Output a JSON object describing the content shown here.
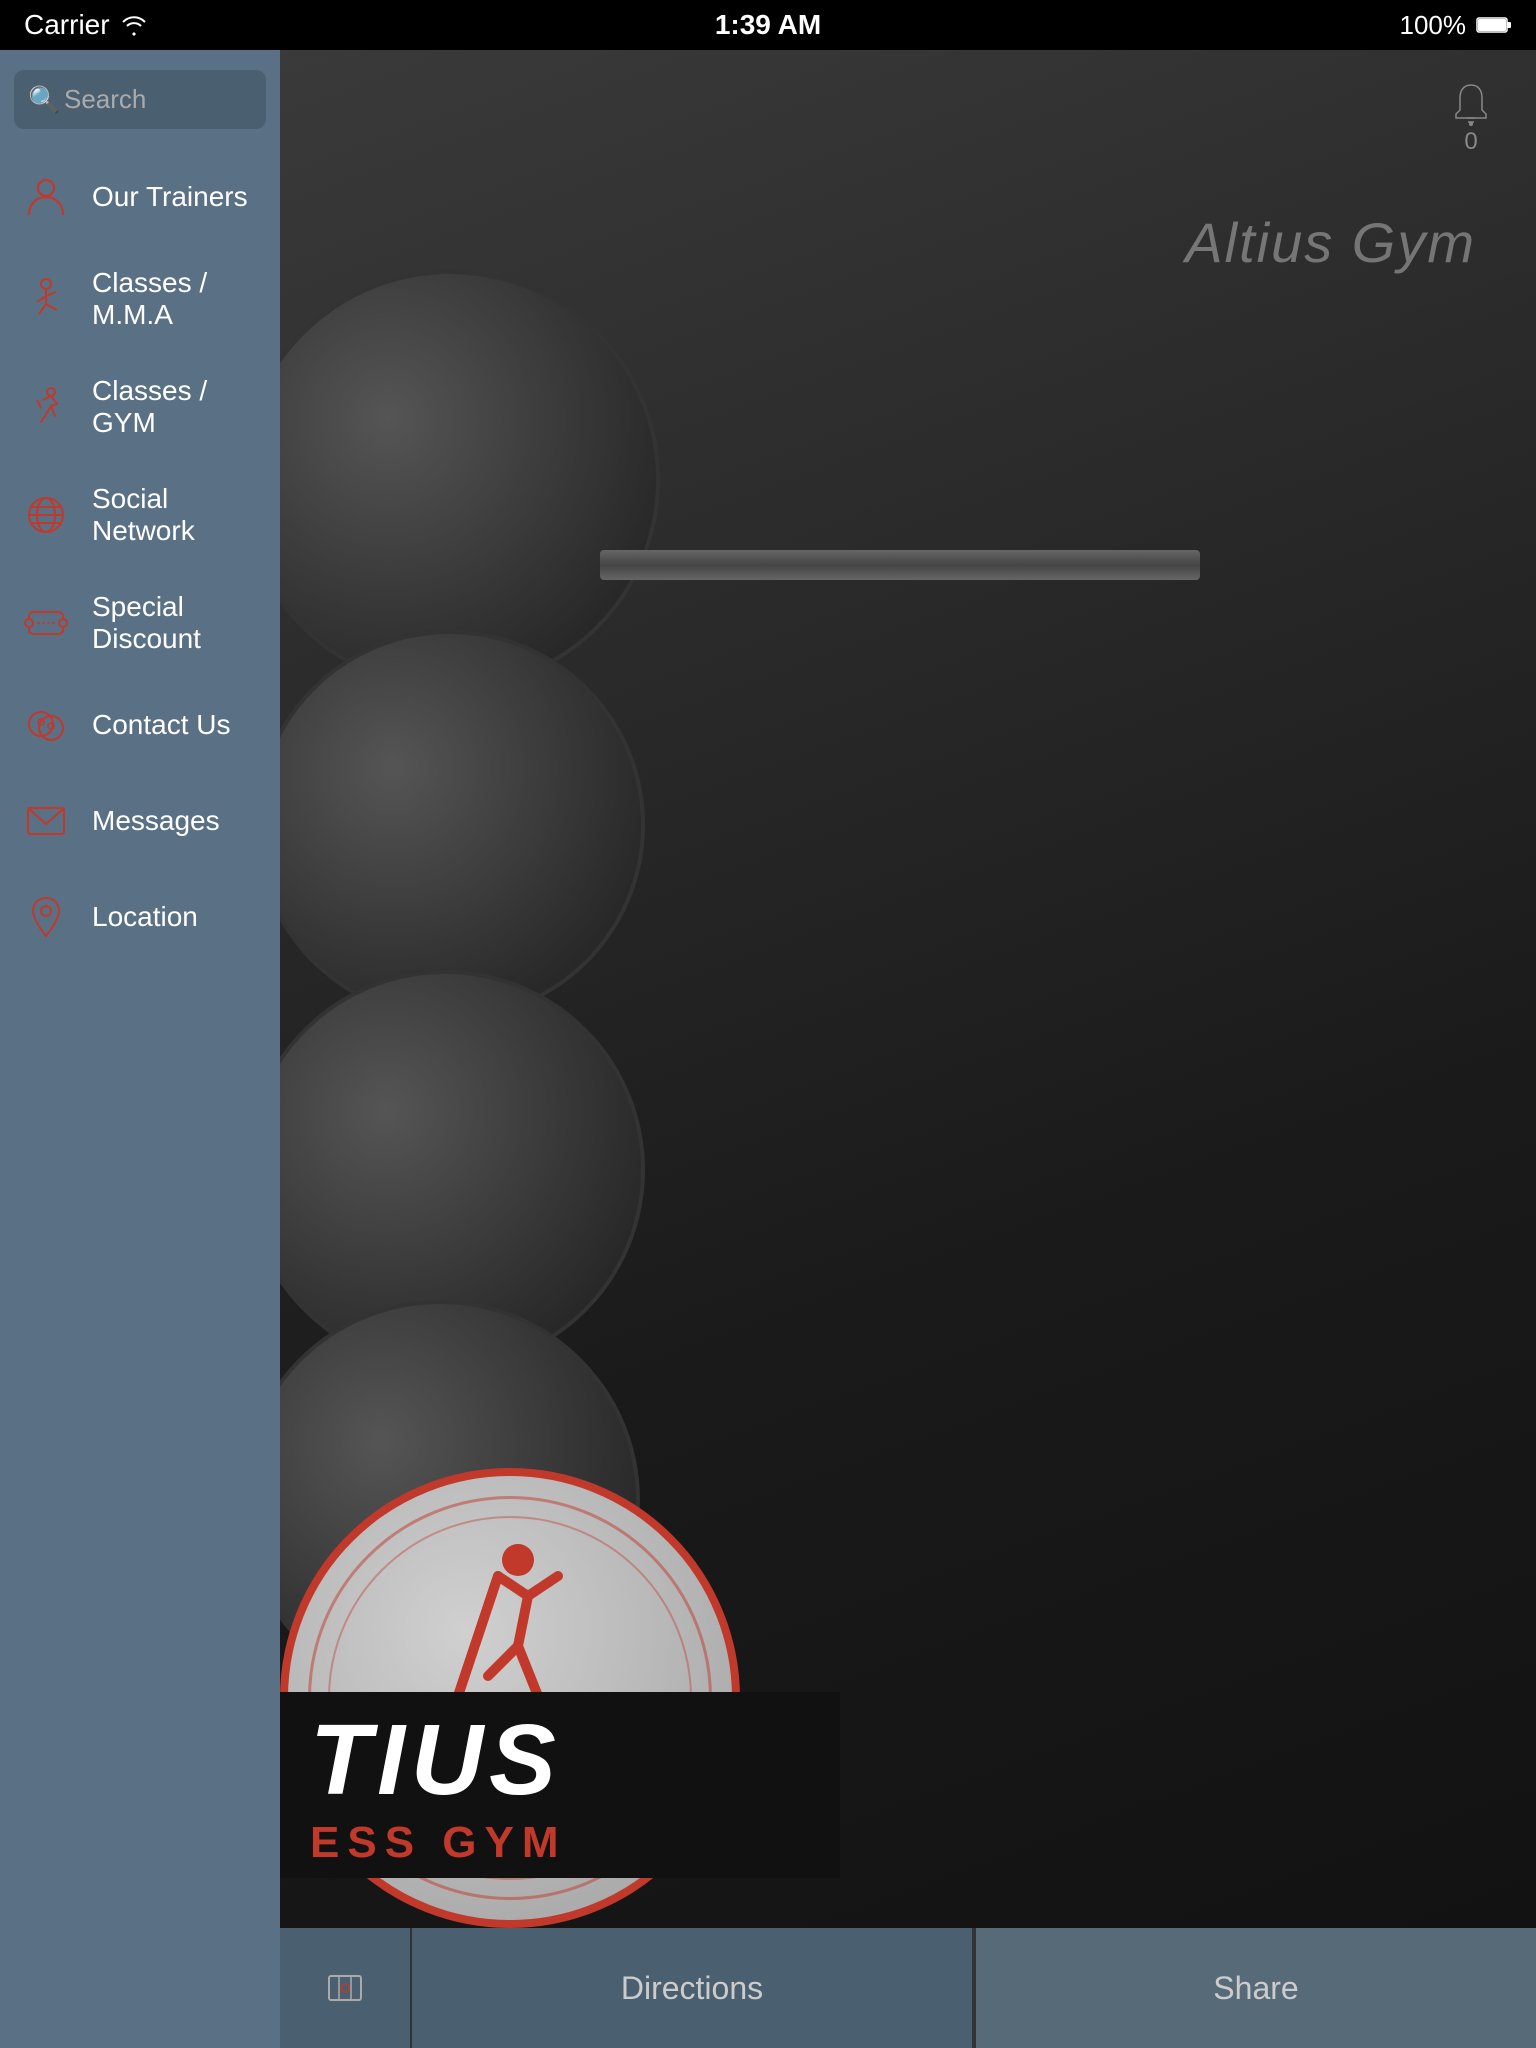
{
  "statusBar": {
    "carrier": "Carrier",
    "time": "1:39 AM",
    "battery": "100%"
  },
  "search": {
    "placeholder": "Search"
  },
  "nav": {
    "items": [
      {
        "id": "our-trainers",
        "label": "Our Trainers",
        "icon": "person"
      },
      {
        "id": "classes-mma",
        "label": "Classes / M.M.A",
        "icon": "mma"
      },
      {
        "id": "classes-gym",
        "label": "Classes / GYM",
        "icon": "gym"
      },
      {
        "id": "social-network",
        "label": "Social Network",
        "icon": "globe"
      },
      {
        "id": "special-discount",
        "label": "Special Discount",
        "icon": "ticket"
      },
      {
        "id": "contact-us",
        "label": "Contact Us",
        "icon": "chat"
      },
      {
        "id": "messages",
        "label": "Messages",
        "icon": "mail"
      },
      {
        "id": "location",
        "label": "Location",
        "icon": "pin"
      }
    ]
  },
  "main": {
    "gymTitle": "Altius Gym",
    "notificationCount": "0",
    "logoTextTop": "TIUS",
    "logoTextBottom": "ESS GYM"
  },
  "bottomBar": {
    "directionsLabel": "Directions",
    "shareLabel": "Share"
  }
}
